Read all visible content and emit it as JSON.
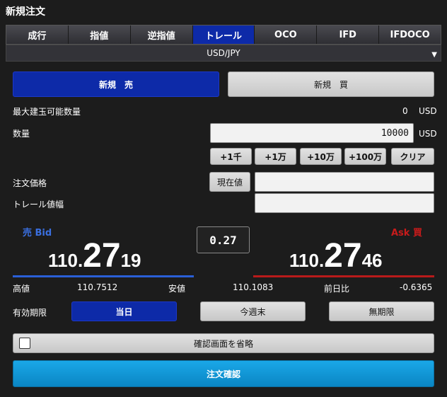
{
  "title": "新規注文",
  "tabs": [
    {
      "label": "成行"
    },
    {
      "label": "指値"
    },
    {
      "label": "逆指値"
    },
    {
      "label": "トレール"
    },
    {
      "label": "OCO"
    },
    {
      "label": "IFD"
    },
    {
      "label": "IFDOCO"
    }
  ],
  "active_tab": "トレール",
  "pair": "USD/JPY",
  "side": {
    "sell_label": "新規　売",
    "buy_label": "新規　買"
  },
  "max_qty": {
    "label": "最大建玉可能数量",
    "value": "0",
    "unit": "USD"
  },
  "qty": {
    "label": "数量",
    "value": "10000",
    "unit": "USD"
  },
  "increments": [
    "+1千",
    "+1万",
    "+10万",
    "+100万"
  ],
  "clear_label": "クリア",
  "order_price": {
    "label": "注文価格",
    "current_button": "現在値",
    "value": ""
  },
  "trail_width": {
    "label": "トレール値幅",
    "value": ""
  },
  "bid": {
    "label": "売 Bid",
    "price_prefix": "110.",
    "price_big": "27",
    "price_suffix": "19"
  },
  "ask": {
    "label": "Ask 買",
    "price_prefix": "110.",
    "price_big": "27",
    "price_suffix": "46"
  },
  "spread": "0.27",
  "stats": {
    "high_label": "高値",
    "high_value": "110.7512",
    "low_label": "安値",
    "low_value": "110.1083",
    "change_label": "前日比",
    "change_value": "-0.6365"
  },
  "expiry": {
    "label": "有効期限",
    "options": [
      "当日",
      "今週末",
      "無期限"
    ],
    "selected": "当日"
  },
  "skip_confirm": {
    "label": "確認画面を省略",
    "checked": false
  },
  "submit_label": "注文確認",
  "colors": {
    "accent_blue": "#0d2aa8",
    "bid": "#3a6fe0",
    "ask": "#c81b1b",
    "confirm": "#0a96d8"
  }
}
